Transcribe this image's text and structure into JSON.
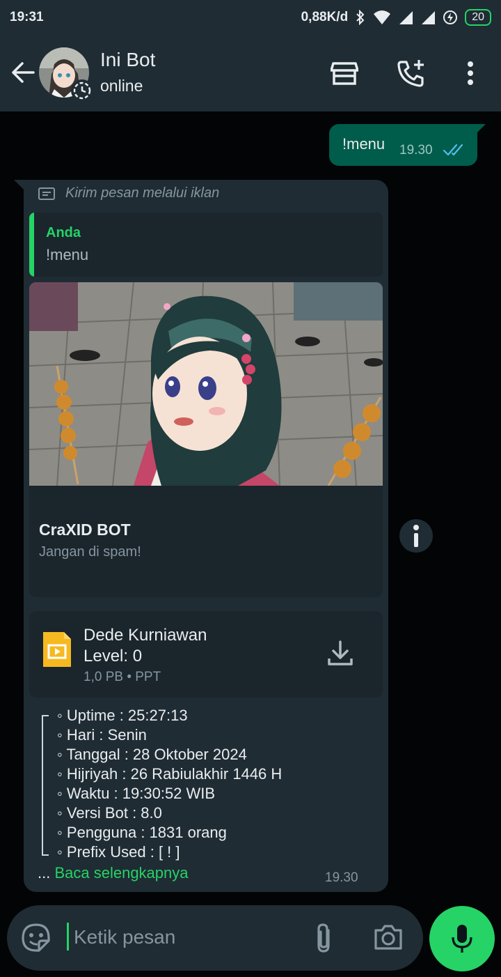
{
  "status_bar": {
    "time": "19:31",
    "net_speed": "0,88K/d",
    "battery": "20"
  },
  "header": {
    "title": "Ini Bot",
    "status": "online"
  },
  "messages": {
    "outgoing": {
      "text": "!menu",
      "time": "19.30"
    },
    "incoming": {
      "ad_label": "Kirim pesan melalui iklan",
      "quote_author": "Anda",
      "quote_text": "!menu",
      "card_title": "CraXID BOT",
      "card_subtitle": "Jangan di spam!",
      "document": {
        "name_line1": "Dede Kurniawan",
        "name_line2": "Level: 0",
        "meta": "1,0 PB • PPT"
      },
      "info_lines": [
        "◦ Uptime : 25:27:13",
        "◦ Hari : Senin",
        "◦ Tanggal : 28 Oktober 2024",
        "◦ Hijriyah : 26 Rabiulakhir 1446 H",
        "◦ Waktu : 19:30:52 WIB",
        "◦ Versi Bot : 8.0",
        "◦ Pengguna : 1831 orang",
        "◦ Prefix Used : [ ! ]"
      ],
      "read_more_prefix": "...",
      "read_more_link": "Baca selengkapnya",
      "time": "19.30"
    }
  },
  "composer": {
    "placeholder": "Ketik pesan"
  },
  "colors": {
    "accent": "#25d366",
    "header_bg": "#1f2c34",
    "outgoing_bubble": "#005c4b",
    "incoming_bubble": "#1f2c34",
    "read_ticks": "#53bdeb"
  },
  "icons": {
    "back": "arrow-left-icon",
    "shop": "storefront-icon",
    "call": "add-call-icon",
    "menu": "more-vert-icon",
    "ad": "ad-card-icon",
    "info": "info-icon",
    "document": "slides-file-icon",
    "download": "download-icon",
    "emoji": "sticker-icon",
    "attach": "paperclip-icon",
    "camera": "camera-icon",
    "mic": "mic-icon"
  }
}
